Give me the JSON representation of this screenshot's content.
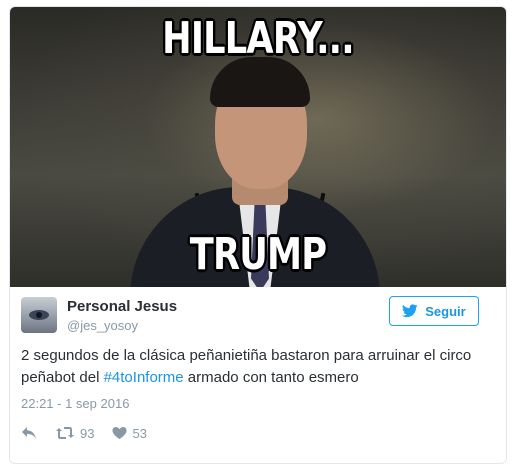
{
  "media": {
    "top_caption": "HILLARY...",
    "bottom_caption": "TRUMP"
  },
  "author": {
    "display_name": "Personal Jesus",
    "handle": "@jes_yosoy",
    "avatar_icon": "eye-avatar"
  },
  "follow_button": {
    "label": "Seguir",
    "icon": "twitter-bird-icon",
    "color": "#1b95e0"
  },
  "tweet": {
    "text_before": "2 segundos de la clásica peñanietiña bastaron para arruinar el circo peñabot del ",
    "hashtag": "#4toInforme",
    "text_after": " armado con tanto esmero",
    "timestamp": "22:21 - 1 sep 2016"
  },
  "actions": {
    "reply_icon": "reply-icon",
    "retweet_icon": "retweet-icon",
    "retweet_count": "93",
    "like_icon": "heart-icon",
    "like_count": "53"
  }
}
